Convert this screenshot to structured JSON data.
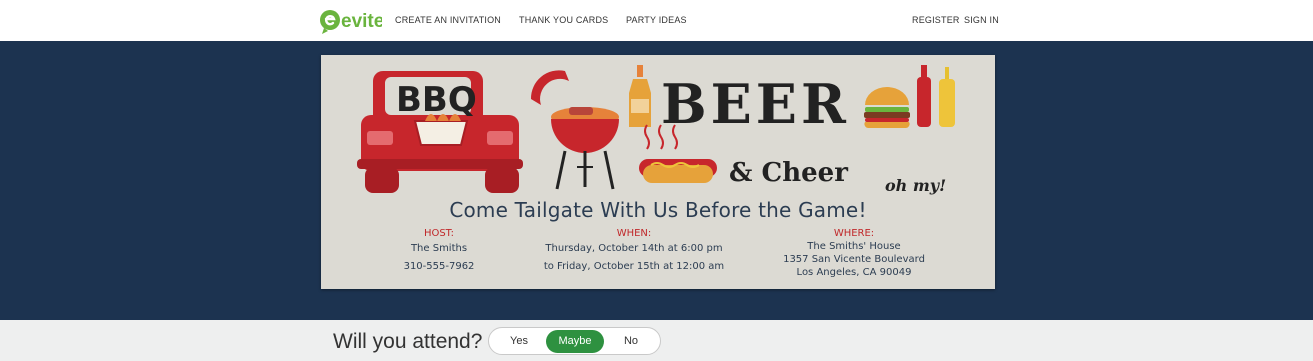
{
  "header": {
    "logo_text": "evite",
    "nav": [
      {
        "label": "CREATE AN INVITATION"
      },
      {
        "label": "THANK YOU CARDS"
      },
      {
        "label": "PARTY IDEAS"
      }
    ],
    "register": "REGISTER",
    "sign_in": "SIGN IN"
  },
  "invitation": {
    "art_title_1": "BBQ",
    "art_title_2": "BEER",
    "art_title_3": "& Cheer",
    "art_title_4": "oh my!",
    "tagline": "Come Tailgate With Us Before the Game!",
    "host": {
      "heading": "HOST:",
      "lines": [
        "The Smiths",
        "310-555-7962"
      ]
    },
    "when": {
      "heading": "WHEN:",
      "lines": [
        "Thursday, October 14th at 6:00 pm",
        "to Friday, October 15th at 12:00 am"
      ]
    },
    "where": {
      "heading": "WHERE:",
      "lines": [
        "The Smiths' House",
        "1357 San Vicente Boulevard",
        "Los Angeles, CA 90049"
      ]
    }
  },
  "rsvp": {
    "question": "Will you attend?",
    "options": [
      "Yes",
      "Maybe",
      "No"
    ],
    "selected": "Maybe"
  },
  "colors": {
    "banner_bg": "#1c3350",
    "accent_green": "#2e9140",
    "host_heading_red": "#c0282a",
    "card_bg": "#dcdad3"
  }
}
